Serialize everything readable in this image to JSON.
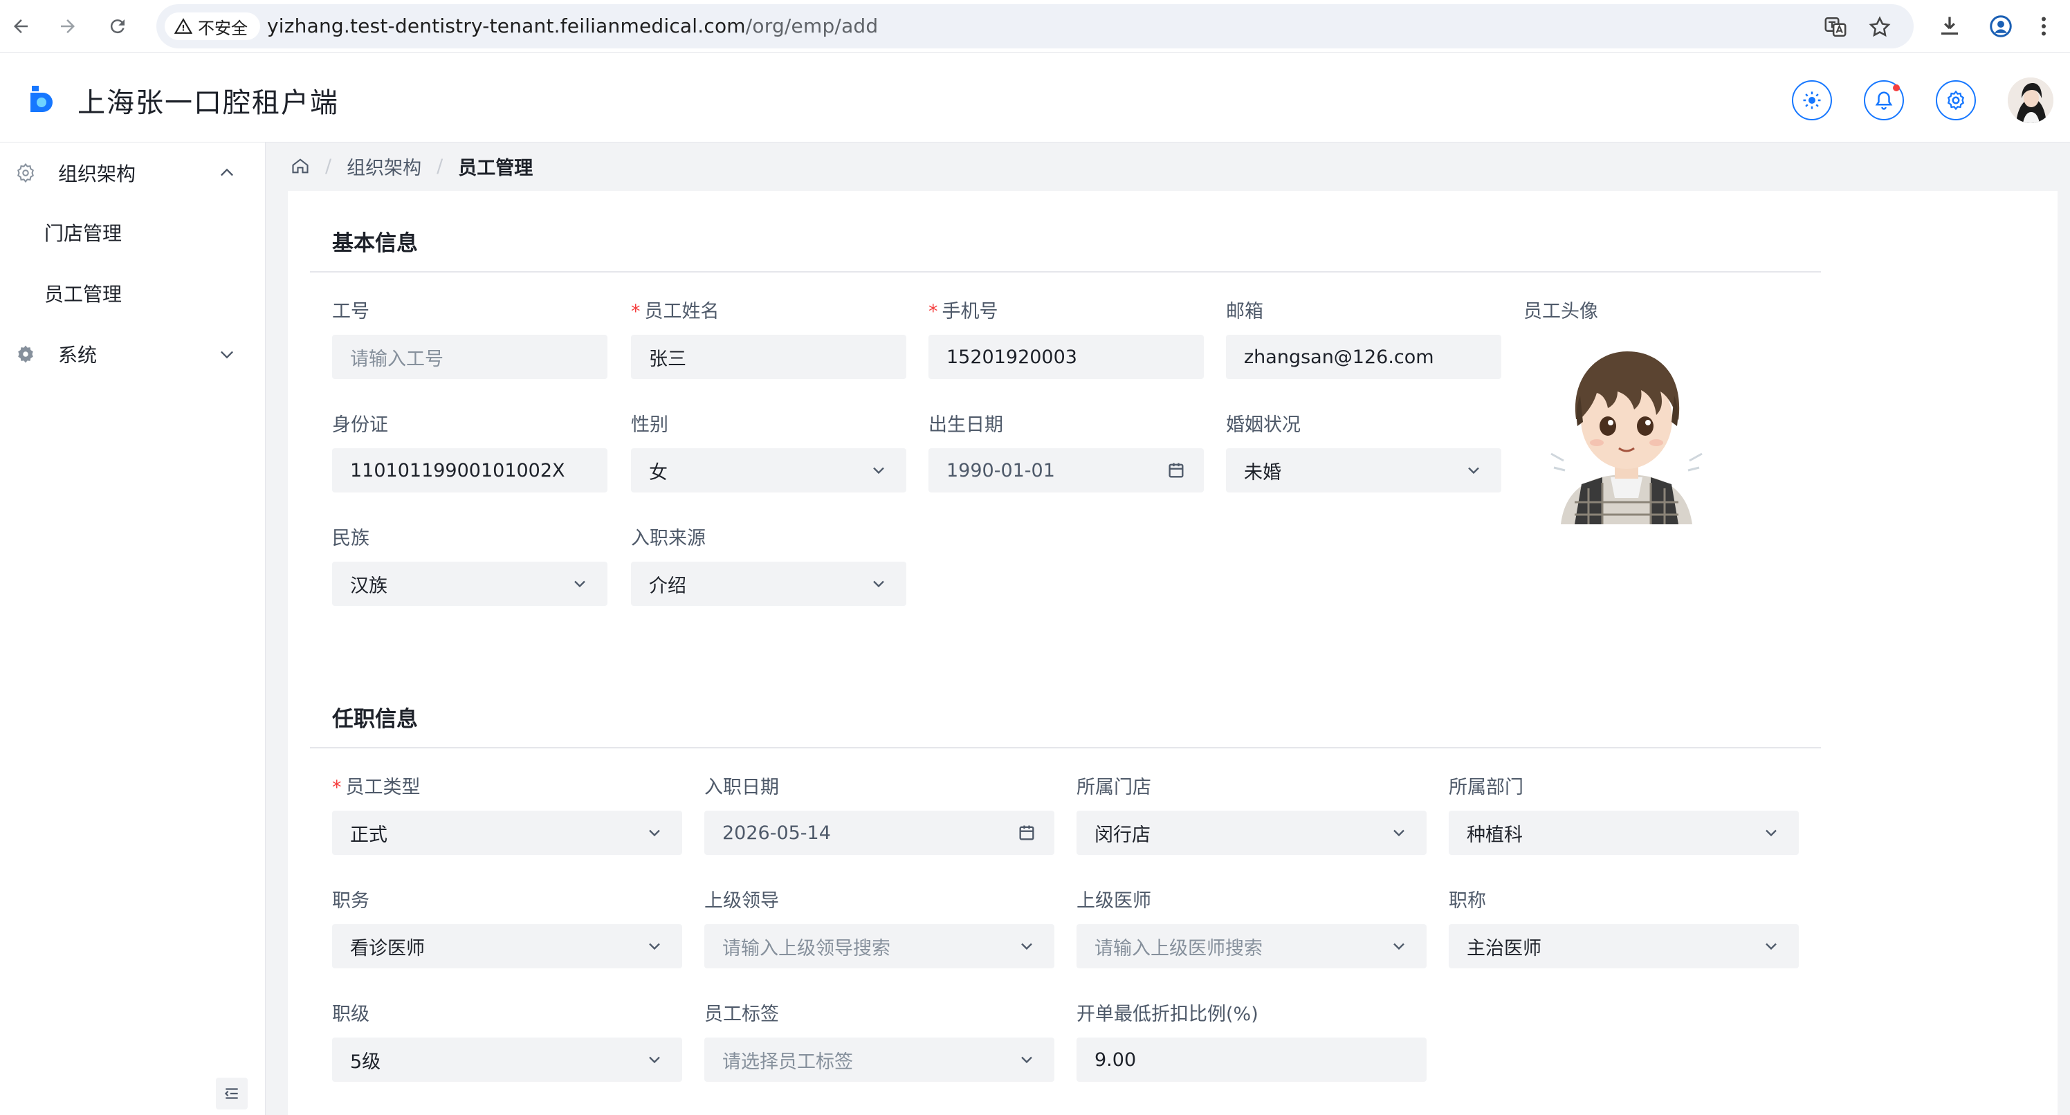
{
  "browser": {
    "security_label": "不安全",
    "url_host": "yizhang.test-dentistry-tenant.feilianmedical.com",
    "url_path": "/org/emp/add"
  },
  "app": {
    "title": "上海张一口腔租户端"
  },
  "sidebar": {
    "groups": [
      {
        "label": "组织架构",
        "icon": "org-icon",
        "expanded": true,
        "items": [
          {
            "label": "门店管理"
          },
          {
            "label": "员工管理"
          }
        ]
      },
      {
        "label": "系统",
        "icon": "gear-icon",
        "expanded": false,
        "items": []
      }
    ]
  },
  "breadcrumb": {
    "items": [
      "组织架构",
      "员工管理"
    ]
  },
  "basic": {
    "title": "基本信息",
    "fields": {
      "emp_no": {
        "label": "工号",
        "value": "",
        "placeholder": "请输入工号"
      },
      "name": {
        "label": "员工姓名",
        "value": "张三",
        "required": true
      },
      "phone": {
        "label": "手机号",
        "value": "15201920003",
        "required": true
      },
      "email": {
        "label": "邮箱",
        "value": "zhangsan@126.com"
      },
      "photo": {
        "label": "员工头像"
      },
      "id_card": {
        "label": "身份证",
        "value": "11010119900101002X"
      },
      "gender": {
        "label": "性别",
        "value": "女"
      },
      "birthday": {
        "label": "出生日期",
        "value": "1990-01-01"
      },
      "marital": {
        "label": "婚姻状况",
        "value": "未婚"
      },
      "ethnicity": {
        "label": "民族",
        "value": "汉族"
      },
      "source": {
        "label": "入职来源",
        "value": "介绍"
      }
    }
  },
  "job": {
    "title": "任职信息",
    "fields": {
      "emp_type": {
        "label": "员工类型",
        "value": "正式",
        "required": true
      },
      "join_date": {
        "label": "入职日期",
        "value": "2026-05-14"
      },
      "store": {
        "label": "所属门店",
        "value": "闵行店"
      },
      "dept": {
        "label": "所属部门",
        "value": "种植科"
      },
      "position": {
        "label": "职务",
        "value": "看诊医师"
      },
      "leader": {
        "label": "上级领导",
        "value": "",
        "placeholder": "请输入上级领导搜索"
      },
      "doctor": {
        "label": "上级医师",
        "value": "",
        "placeholder": "请输入上级医师搜索"
      },
      "title_rank": {
        "label": "职称",
        "value": "主治医师"
      },
      "level": {
        "label": "职级",
        "value": "5级"
      },
      "tags": {
        "label": "员工标签",
        "value": "",
        "placeholder": "请选择员工标签"
      },
      "discount": {
        "label": "开单最低折扣比例(%)",
        "value": "9.00"
      }
    }
  },
  "colors": {
    "primary": "#1677ff",
    "required": "#f53f3f",
    "input_bg": "#f2f3f5"
  }
}
